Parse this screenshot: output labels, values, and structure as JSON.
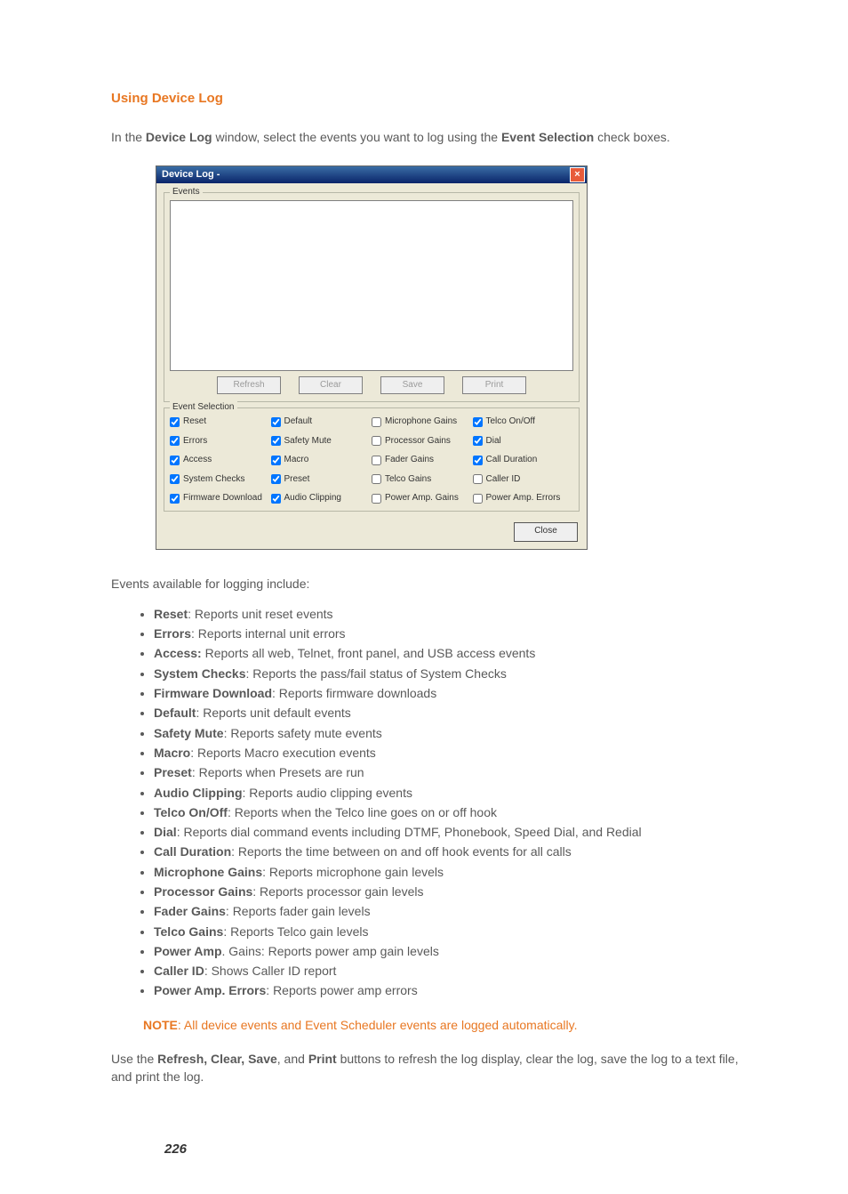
{
  "heading": "Using Device Log",
  "intro": {
    "pre": "In the ",
    "b1": "Device Log",
    "mid": " window, select the events you want to log using the ",
    "b2": "Event Selection",
    "post": " check boxes."
  },
  "shot": {
    "title": "Device Log -",
    "close_glyph": "×",
    "events_label": "Events",
    "buttons": {
      "refresh": "Refresh",
      "clear": "Clear",
      "save": "Save",
      "print": "Print"
    },
    "selection_label": "Event Selection",
    "close_button": "Close",
    "checks": {
      "c1": {
        "label": "Reset",
        "checked": true
      },
      "c2": {
        "label": "Errors",
        "checked": true
      },
      "c3": {
        "label": "Access",
        "checked": true
      },
      "c4": {
        "label": "System Checks",
        "checked": true
      },
      "c5": {
        "label": "Firmware Download",
        "checked": true
      },
      "c6": {
        "label": "Default",
        "checked": true
      },
      "c7": {
        "label": "Safety Mute",
        "checked": true
      },
      "c8": {
        "label": "Macro",
        "checked": true
      },
      "c9": {
        "label": "Preset",
        "checked": true
      },
      "c10": {
        "label": "Audio Clipping",
        "checked": true
      },
      "c11": {
        "label": "Microphone Gains",
        "checked": false
      },
      "c12": {
        "label": "Processor Gains",
        "checked": false
      },
      "c13": {
        "label": "Fader Gains",
        "checked": false
      },
      "c14": {
        "label": "Telco Gains",
        "checked": false
      },
      "c15": {
        "label": "Power Amp. Gains",
        "checked": false
      },
      "c16": {
        "label": "Telco On/Off",
        "checked": true
      },
      "c17": {
        "label": "Dial",
        "checked": true
      },
      "c18": {
        "label": "Call Duration",
        "checked": true
      },
      "c19": {
        "label": "Caller ID",
        "checked": false
      },
      "c20": {
        "label": "Power Amp. Errors",
        "checked": false
      }
    }
  },
  "after": "Events available for logging include:",
  "evlist": [
    {
      "label": "Reset",
      "desc": ": Reports unit reset events"
    },
    {
      "label": "Errors",
      "desc": ": Reports internal unit errors"
    },
    {
      "label": "Access:",
      "desc": " Reports all web, Telnet, front panel, and USB access events"
    },
    {
      "label": "System Checks",
      "desc": ": Reports the pass/fail status of System Checks"
    },
    {
      "label": "Firmware Download",
      "desc": ": Reports firmware downloads"
    },
    {
      "label": "Default",
      "desc": ": Reports unit default events"
    },
    {
      "label": "Safety Mute",
      "desc": ": Reports safety mute events"
    },
    {
      "label": "Macro",
      "desc": ": Reports Macro execution events"
    },
    {
      "label": "Preset",
      "desc": ": Reports when Presets are run"
    },
    {
      "label": "Audio Clipping",
      "desc": ": Reports audio clipping events"
    },
    {
      "label": "Telco On/Off",
      "desc": ": Reports when the Telco line goes on or off hook"
    },
    {
      "label": "Dial",
      "desc": ": Reports dial command events including DTMF, Phonebook, Speed Dial, and Redial"
    },
    {
      "label": "Call Duration",
      "desc": ": Reports the time between on and off hook events for all calls"
    },
    {
      "label": "Microphone Gains",
      "desc": ": Reports microphone gain levels"
    },
    {
      "label": "Processor Gains",
      "desc": ": Reports processor gain levels"
    },
    {
      "label": "Fader Gains",
      "desc": ": Reports fader gain levels"
    },
    {
      "label": "Telco Gains",
      "desc": ": Reports Telco gain levels"
    },
    {
      "label": "Power Amp",
      "desc": ". Gains: Reports power amp gain levels"
    },
    {
      "label": "Caller ID",
      "desc": ": Shows Caller ID report"
    },
    {
      "label": "Power Amp. Errors",
      "desc": ": Reports power amp errors"
    }
  ],
  "note": {
    "label": "NOTE",
    "text": ": All device events and Event Scheduler events are logged automatically."
  },
  "final": {
    "pre": "Use the ",
    "b1": "Refresh, Clear, Save",
    "mid": ", and ",
    "b2": "Print",
    "post": " buttons to refresh the log display, clear the log, save the log to a text file, and print the log."
  },
  "page_number": "226"
}
